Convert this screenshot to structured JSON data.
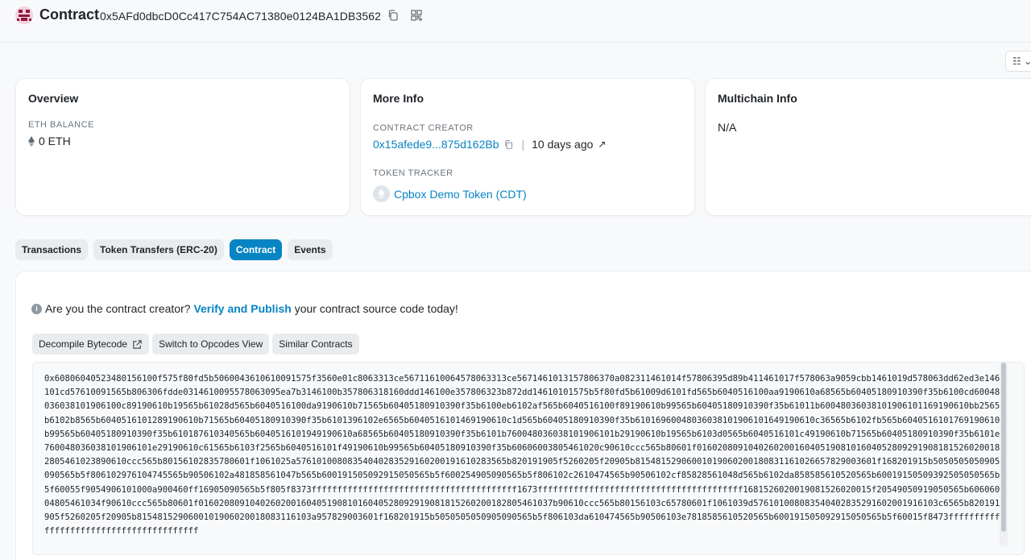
{
  "header": {
    "title": "Contract",
    "address": "0x5AFd0dbcD0Cc417C754AC71380e0124BA1DB3562"
  },
  "overview": {
    "title": "Overview",
    "balance_label": "ETH BALANCE",
    "balance_value": "0 ETH"
  },
  "more_info": {
    "title": "More Info",
    "creator_label": "CONTRACT CREATOR",
    "creator_address": "0x15afede9...875d162Bb",
    "separator": "|",
    "created_ago": "10 days ago",
    "tracker_label": "TOKEN TRACKER",
    "tracker_name": "Cpbox Demo Token (CDT)"
  },
  "multichain": {
    "title": "Multichain Info",
    "value": "N/A"
  },
  "tabs": [
    {
      "label": "Transactions",
      "active": false
    },
    {
      "label": "Token Transfers (ERC-20)",
      "active": false
    },
    {
      "label": "Contract",
      "active": true
    },
    {
      "label": "Events",
      "active": false
    }
  ],
  "notice": {
    "prefix": "Are you the contract creator?",
    "link": "Verify and Publish",
    "suffix": "your contract source code today!"
  },
  "actions": {
    "decompile": "Decompile Bytecode",
    "opcodes": "Switch to Opcodes View",
    "similar": "Similar Contracts"
  },
  "bytecode": "0x60806040523480156100f575f80fd5b5060043610610091575f3560e01c8063313ce56711610064578063313ce56714610131578063 70a082311461014f57806395d89b411461017f578063a9059cbb1461019d578063dd62ed3e146101cd57610091565b806306fdde0314610095578063095ea7b3146100b357806318160ddd146100e357806323b872dd14610101575b5f80fd5b61009d6101fd565b6040516100aa9190610a68565b60405180910390f35b6100cd60048036038101906100c89190610b19565b61028d565b6040516100da9190610b71565b60405180910390f35b6100eb6102af565b6040516100f89190610b99565b60405180910390f35b61011b60048036038101906101169190610bb2565b6102b8565b6040516101289190610b71565b60405180910390f35b6101396102e6565b6040516101469190610c1d565b60405180910390f35b61016960048036038101906101649190610c36565b6102fb565b6040516101769190610b99565b60405180910390f35b610187610340565b6040516101949190610a68565b60405180910390f35b6101b760048036038101906101b29190610b19565b6103d0565b6040516101c49190610b71565b60405180910390f35b6101e760048036038101906101e29190610c61565b6103f2565b6040516101f49190610b99565b60405180910390f35b60606003805461020c90610ccc565b80601f016020809104026020016040519081016040528092919081815260200182805461023890610ccc565b80156102835780601f1061025a5761010080835404028352916020019161028356 5b820191905f5260205f20905b8154815290600101906020018083116102665782900360 1f168201915b5050505050905090565b5f806102976104745565b9050610 2a481858561047b565b60019150509291505056 5b5f600254905090565b5f806102c2610474565b90506102cf85828561048d565b6102da8585856105205 65b60019150509392505050565b5f60055f9054906101000a900460ff16905090565b5f805f8373ffffffffffffffffffffffffffffffffffffffff1673ffffffffffffffffffffffffffffffffffffffff168152602001908152602001 5f2054905091905056 5b60606004805461034f90610ccc565b80601f016020809104026020016040519081016040528092919081815260200182805461037b90610ccc565b80156103c65780601f1061039d5761010080835404028352916020019161 03c6565b820191905f5260205f20905b8154815290600101906020018083116103a957829003601f168201915b5050505050905090565b5f806103da610474565b90506103e78185856105205 65b600191505092915050565b5f60015f8473ffffffffffffffffffffffffffffffffffffffff"
}
